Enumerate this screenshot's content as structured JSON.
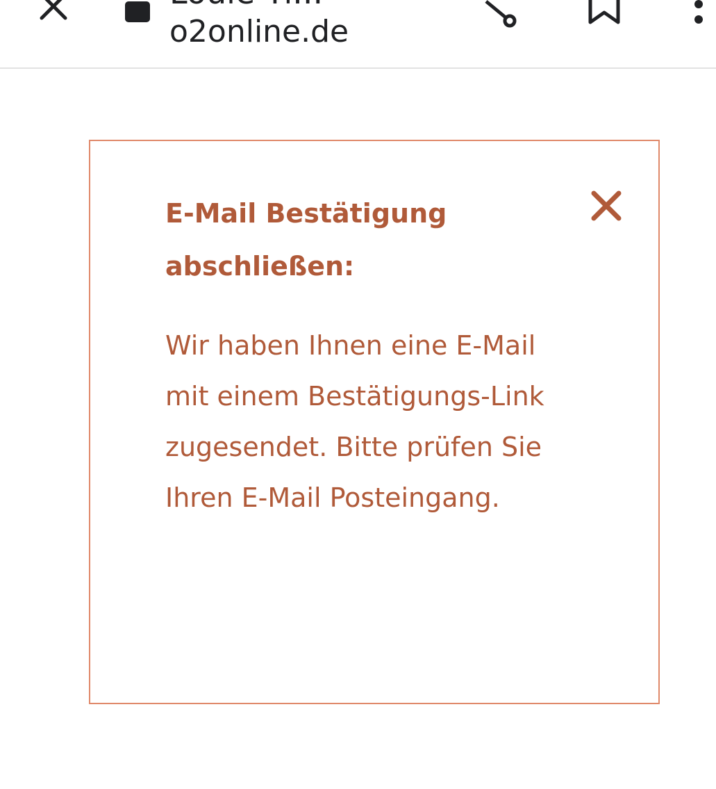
{
  "browser": {
    "tab_title": "Louie Ti...",
    "url": "o2online.de",
    "icons": {
      "close": "close-icon",
      "lock": "lock-icon",
      "share": "share-icon",
      "bookmark": "bookmark-icon",
      "menu": "more-vert-icon"
    }
  },
  "notice": {
    "heading": "E-Mail Bestätigung abschließen:",
    "body": "Wir haben Ihnen eine E-Mail mit einem Bestätigungs-Link zugesendet. Bitte prüfen Sie Ihren E-Mail Posteingang.",
    "close_icon": "close-icon"
  },
  "colors": {
    "accent_text": "#b05a39",
    "card_border": "#e0896a",
    "toolbar_text": "#202124"
  }
}
